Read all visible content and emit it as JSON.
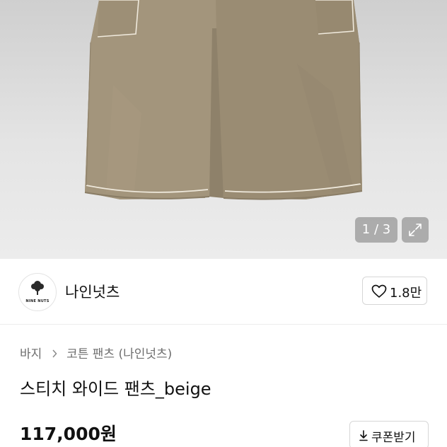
{
  "gallery": {
    "counter": "1 / 3",
    "image_icon": "pants-photo",
    "expand_icon": "expand-icon"
  },
  "shop": {
    "logo_text": "NINE NUTS",
    "name": "나인넛츠",
    "like_count": "1.8만",
    "like_icon": "heart-icon"
  },
  "breadcrumb": {
    "items": [
      "바지",
      "코튼 팬츠 (나인넛츠)"
    ],
    "separator_icon": "chevron-right-icon"
  },
  "product": {
    "title": "스티치 와이드 팬츠_beige",
    "price": "117,000원",
    "coupon_label": "쿠폰받기",
    "coupon_icon": "download-icon"
  },
  "colors": {
    "pants": "#9f9178",
    "stitch": "#efe9dc",
    "background": "#e6e6e6"
  }
}
